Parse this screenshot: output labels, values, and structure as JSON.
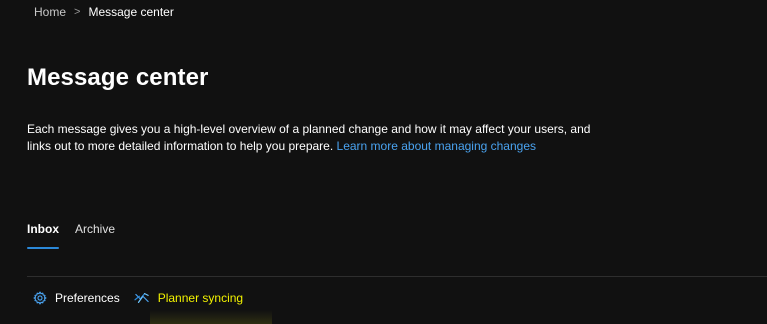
{
  "breadcrumb": {
    "home": "Home",
    "separator": ">",
    "current": "Message center"
  },
  "page": {
    "title": "Message center",
    "description": "Each message gives you a high-level overview of a planned change and how it may affect your users, and links out to more detailed information to help you prepare.",
    "learn_more_link": "Learn more about managing changes"
  },
  "tabs": [
    {
      "label": "Inbox",
      "active": true
    },
    {
      "label": "Archive",
      "active": false
    }
  ],
  "toolbar": {
    "preferences": {
      "label": "Preferences",
      "icon": "gear-icon"
    },
    "planner_syncing": {
      "label": "Planner syncing",
      "icon": "planner-sync-icon"
    }
  },
  "colors": {
    "background": "#111111",
    "link": "#4aa3f0",
    "tab_indicator": "#2b88d8",
    "highlight_text": "#f2f200"
  }
}
